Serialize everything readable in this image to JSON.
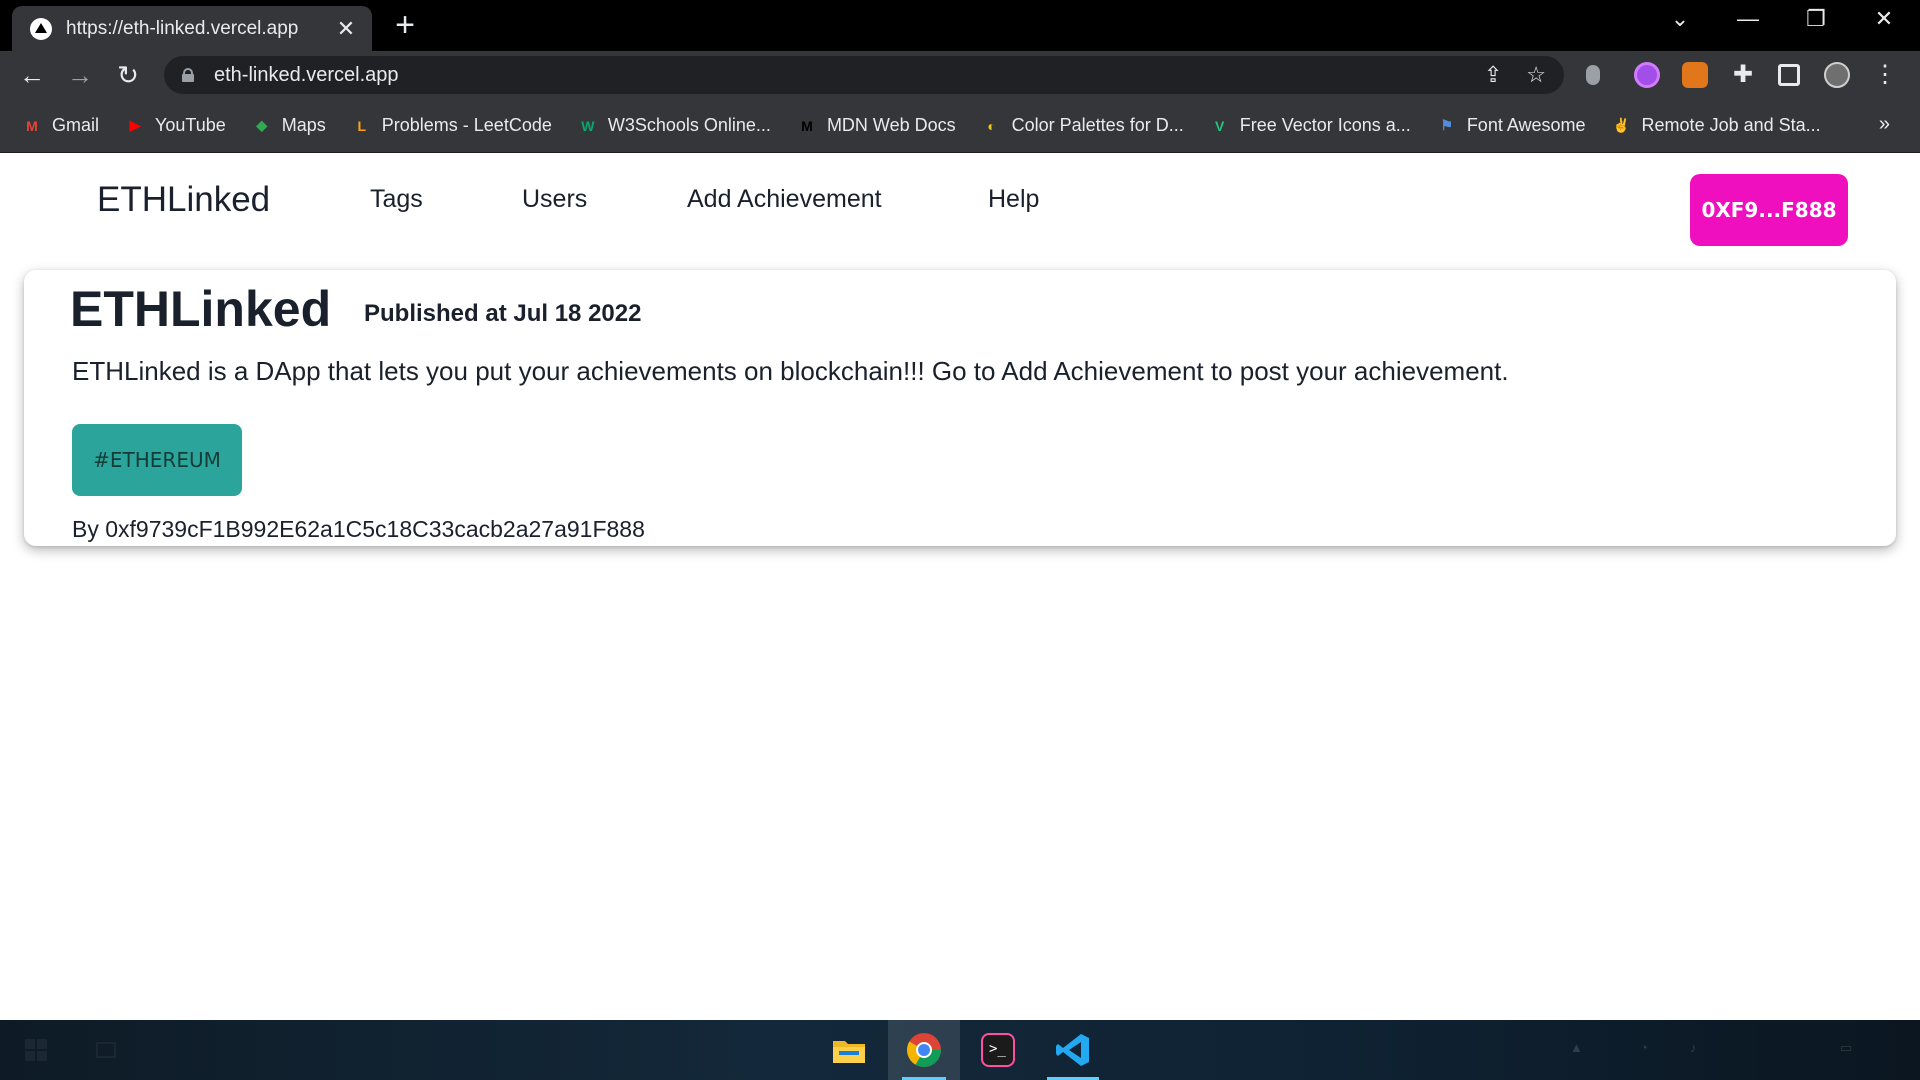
{
  "browser": {
    "tab_title": "https://eth-linked.vercel.app",
    "tab_close": "✕",
    "new_tab": "+",
    "url": "eth-linked.vercel.app",
    "more_bookmarks": "»",
    "bookmarks": [
      {
        "label": "Gmail",
        "icon": "gmail-icon",
        "color": "#ea4335",
        "glyph": "M"
      },
      {
        "label": "YouTube",
        "icon": "youtube-icon",
        "color": "#ff0000",
        "glyph": "▶"
      },
      {
        "label": "Maps",
        "icon": "maps-icon",
        "color": "#34a853",
        "glyph": "◆"
      },
      {
        "label": "Problems - LeetCode",
        "icon": "leetcode-icon",
        "color": "#ffa116",
        "glyph": "L"
      },
      {
        "label": "W3Schools Online...",
        "icon": "w3schools-icon",
        "color": "#04aa6d",
        "glyph": "W"
      },
      {
        "label": "MDN Web Docs",
        "icon": "mdn-icon",
        "color": "#000000",
        "glyph": "M"
      },
      {
        "label": "Color Palettes for D...",
        "icon": "palette-icon",
        "color": "#f5c518",
        "glyph": "◐"
      },
      {
        "label": "Free Vector Icons a...",
        "icon": "vector-icons-icon",
        "color": "#26c281",
        "glyph": "V"
      },
      {
        "label": "Font Awesome",
        "icon": "flag-icon",
        "color": "#538dd7",
        "glyph": "⚑"
      },
      {
        "label": "Remote Job and Sta...",
        "icon": "angellist-icon",
        "color": "#ffffff",
        "glyph": "✌"
      }
    ]
  },
  "site": {
    "brand": "ETHLinked",
    "nav": [
      "Tags",
      "Users",
      "Add Achievement",
      "Help"
    ],
    "wallet": "0XF9...F888"
  },
  "post": {
    "title": "ETHLinked",
    "published": "Published at Jul 18 2022",
    "description": "ETHLinked is a DApp that lets you put your achievements on blockchain!!! Go to Add Achievement to post your achievement.",
    "tag": "#ETHEREUM",
    "author": "By 0xf9739cF1B992E62a1C5c18C33cacb2a27a91F888"
  },
  "colors": {
    "accent_pink": "#f00fbf",
    "tag_teal": "#2ba59b"
  }
}
